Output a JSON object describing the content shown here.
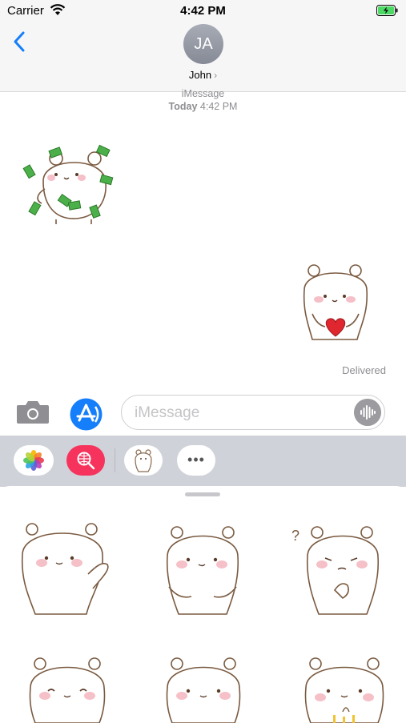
{
  "status": {
    "carrier": "Carrier",
    "time": "4:42 PM"
  },
  "header": {
    "initials": "JA",
    "name": "John",
    "chevron": "›"
  },
  "thread": {
    "service": "iMessage",
    "day": "Today",
    "time": "4:42 PM",
    "delivered": "Delivered"
  },
  "composer": {
    "placeholder": "iMessage"
  },
  "drawer": {
    "more": "•••"
  },
  "colors": {
    "accent": "#147efb",
    "search_app": "#f6335c",
    "bubble_grey": "#cfd2d8"
  }
}
